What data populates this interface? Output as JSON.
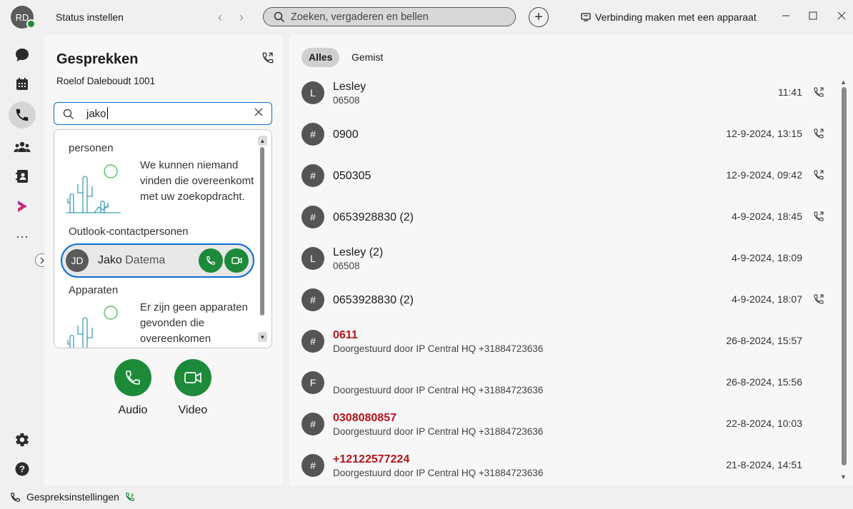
{
  "titlebar": {
    "avatar_initials": "RD",
    "status_label": "Status instellen",
    "search_placeholder": "Zoeken, vergaderen en bellen",
    "connect_device": "Verbinding maken met een apparaat"
  },
  "colors": {
    "accent_blue": "#0a6ed1",
    "call_green": "#1d8a3a",
    "missed_red": "#b3141c"
  },
  "calls": {
    "title": "Gesprekken",
    "line_name": "Roelof Daleboudt 1001",
    "search_value": "jako",
    "dropdown": {
      "people_header": "personen",
      "people_empty": "We kunnen niemand vinden die overeenkomt met uw zoekopdracht.",
      "outlook_header": "Outlook-contactpersonen",
      "contact": {
        "initials": "JD",
        "first": "Jako",
        "last": "Datema"
      },
      "devices_header": "Apparaten",
      "devices_empty": "Er zijn geen apparaten gevonden die overeenkomen"
    },
    "audio_label": "Audio",
    "video_label": "Video"
  },
  "bottom": {
    "call_settings": "Gespreksinstellingen"
  },
  "history": {
    "tabs": [
      "Alles",
      "Gemist"
    ],
    "rows": [
      {
        "initial": "L",
        "name": "Lesley",
        "sub": "06508",
        "time": "11:41",
        "missed": false,
        "icon": true
      },
      {
        "initial": "#",
        "name": "0900",
        "sub": "",
        "time": "12-9-2024, 13:15",
        "missed": false,
        "icon": true
      },
      {
        "initial": "#",
        "name": "050305",
        "sub": "",
        "time": "12-9-2024, 09:42",
        "missed": false,
        "icon": true
      },
      {
        "initial": "#",
        "name": "0653928830 (2)",
        "sub": "",
        "time": "4-9-2024, 18:45",
        "missed": false,
        "icon": true
      },
      {
        "initial": "L",
        "name": "Lesley (2)",
        "sub": "06508",
        "time": "4-9-2024, 18:09",
        "missed": false,
        "icon": false
      },
      {
        "initial": "#",
        "name": "0653928830 (2)",
        "sub": "",
        "time": "4-9-2024, 18:07",
        "missed": false,
        "icon": true
      },
      {
        "initial": "#",
        "name": "0611",
        "sub": "Doorgestuurd door IP Central HQ +31884723636",
        "time": "26-8-2024, 15:57",
        "missed": true,
        "icon": false
      },
      {
        "initial": "F",
        "name": "",
        "sub": "Doorgestuurd door IP Central HQ +31884723636",
        "time": "26-8-2024, 15:56",
        "missed": false,
        "icon": false
      },
      {
        "initial": "#",
        "name": "0308080857",
        "sub": "Doorgestuurd door IP Central HQ +31884723636",
        "time": "22-8-2024, 10:03",
        "missed": true,
        "icon": false
      },
      {
        "initial": "#",
        "name": "+12122577224",
        "sub": "Doorgestuurd door IP Central HQ +31884723636",
        "time": "21-8-2024, 14:51",
        "missed": true,
        "icon": false
      }
    ]
  }
}
